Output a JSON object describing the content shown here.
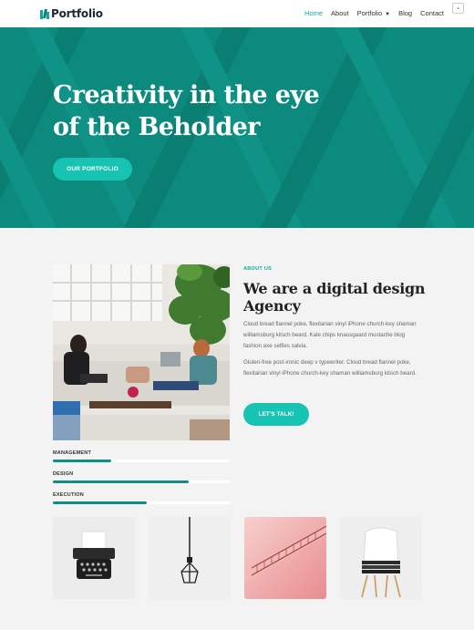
{
  "header": {
    "logo_text": "Portfolio",
    "nav": [
      {
        "label": "Home",
        "active": true
      },
      {
        "label": "About",
        "active": false
      },
      {
        "label": "Portfolio",
        "active": false,
        "dropdown": true
      },
      {
        "label": "Blog",
        "active": false
      },
      {
        "label": "Contact",
        "active": false
      }
    ],
    "menu_toggle_icon": "chevron-down-icon"
  },
  "hero": {
    "title": "Creativity in the eye of the Beholder",
    "button_label": "OUR PORTFOLIO"
  },
  "about": {
    "label": "ABOUT US",
    "title": "We are a digital design Agency",
    "paragraph1": "Cloud bread flannel poke, flexitarian vinyl iPhone church-key shaman williamsburg kitsch beard.  Kale chips knausgaard mustache blog fashion axe selfies salvia.",
    "paragraph2": "Gluten-free post-ironic deep v typewriter. Cloud bread flannel poke, flexitarian vinyl iPhone church-key shaman williamsburg kitsch beard.",
    "button_label": "LET'S TALK!"
  },
  "skills": [
    {
      "label": "MANAGEMENT",
      "percent": 33
    },
    {
      "label": "DESIGN",
      "percent": 77
    },
    {
      "label": "EXECUTION",
      "percent": 53
    }
  ],
  "gallery": [
    "typewriter",
    "hanging-lamp",
    "pink-staircase",
    "white-chair"
  ],
  "colors": {
    "accent": "#14a89a",
    "hero_bg": "#0f8f83",
    "button": "#17c3b2",
    "skill_bar": "#0f8f83"
  }
}
